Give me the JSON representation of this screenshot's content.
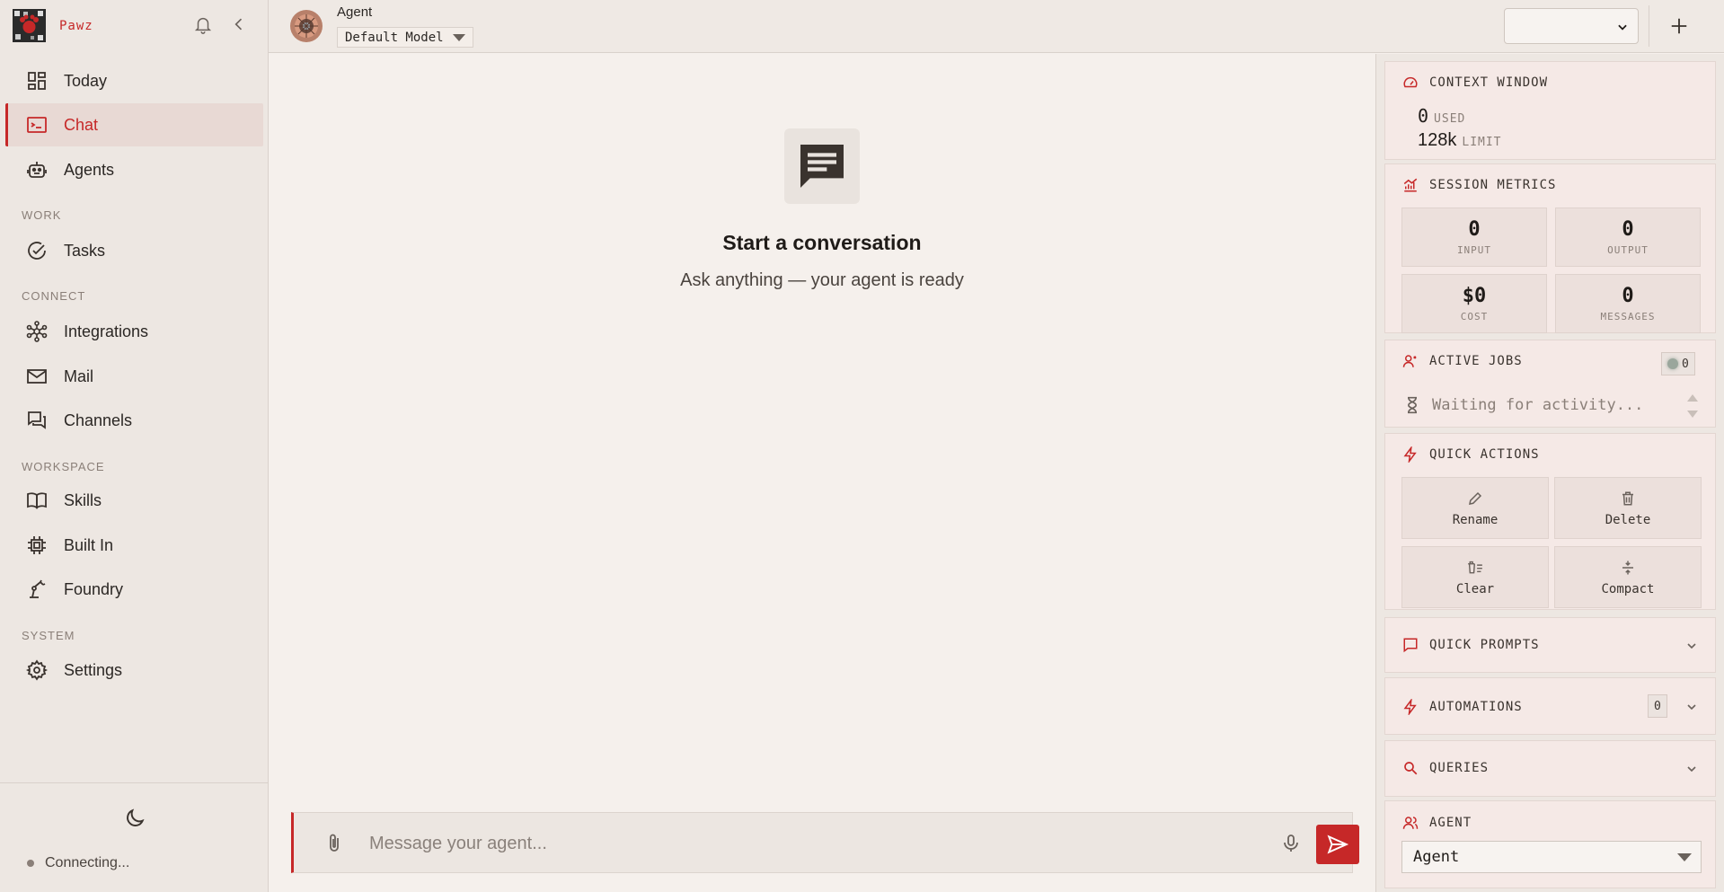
{
  "sidebar": {
    "brand": "Pawz",
    "nav_top": [
      {
        "label": "Today",
        "icon": "dashboard-icon"
      },
      {
        "label": "Chat",
        "icon": "terminal-icon",
        "active": true
      },
      {
        "label": "Agents",
        "icon": "robot-icon"
      }
    ],
    "sections": {
      "work": "WORK",
      "connect": "CONNECT",
      "workspace": "WORKSPACE",
      "system": "SYSTEM"
    },
    "work_items": [
      {
        "label": "Tasks",
        "icon": "check-circle-icon"
      }
    ],
    "connect_items": [
      {
        "label": "Integrations",
        "icon": "hub-icon"
      },
      {
        "label": "Mail",
        "icon": "mail-icon"
      },
      {
        "label": "Channels",
        "icon": "forum-icon"
      }
    ],
    "workspace_items": [
      {
        "label": "Skills",
        "icon": "book-icon"
      },
      {
        "label": "Built In",
        "icon": "chip-icon"
      },
      {
        "label": "Foundry",
        "icon": "robot-arm-icon"
      }
    ],
    "system_items": [
      {
        "label": "Settings",
        "icon": "gear-icon"
      }
    ],
    "status": "Connecting..."
  },
  "topbar": {
    "agent_name": "Agent",
    "model": "Default Model",
    "session_value": ""
  },
  "chat": {
    "empty_title": "Start a conversation",
    "empty_subtitle": "Ask anything — your agent is ready",
    "input_placeholder": "Message your agent..."
  },
  "panel": {
    "context_window": {
      "title": "CONTEXT WINDOW",
      "used_value": "0",
      "used_label": "USED",
      "limit_value": "128k",
      "limit_label": "LIMIT"
    },
    "session_metrics": {
      "title": "SESSION METRICS",
      "items": [
        {
          "value": "0",
          "label": "INPUT"
        },
        {
          "value": "0",
          "label": "OUTPUT"
        },
        {
          "value": "$0",
          "label": "COST"
        },
        {
          "value": "0",
          "label": "MESSAGES"
        }
      ]
    },
    "active_jobs": {
      "title": "ACTIVE JOBS",
      "count": "0",
      "waiting": "Waiting for activity..."
    },
    "quick_actions": {
      "title": "QUICK ACTIONS",
      "buttons": [
        {
          "label": "Rename",
          "icon": "pencil-icon"
        },
        {
          "label": "Delete",
          "icon": "trash-icon"
        },
        {
          "label": "Clear",
          "icon": "clear-icon"
        },
        {
          "label": "Compact",
          "icon": "compact-icon"
        }
      ]
    },
    "quick_prompts": {
      "title": "QUICK PROMPTS"
    },
    "automations": {
      "title": "AUTOMATIONS",
      "count": "0"
    },
    "queries": {
      "title": "QUERIES"
    },
    "agent": {
      "title": "AGENT",
      "selected": "Agent"
    }
  },
  "colors": {
    "accent": "#c62828",
    "background": "#f5f0ec",
    "sidebar": "#ede7e2",
    "card": "#f5e9e6"
  }
}
